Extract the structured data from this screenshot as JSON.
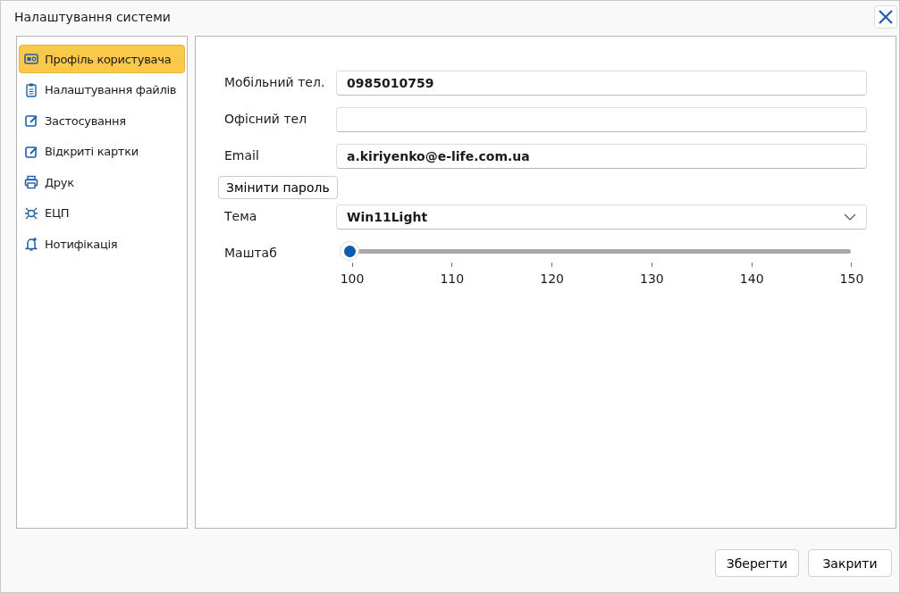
{
  "window": {
    "title": "Налаштування системи"
  },
  "sidebar": {
    "items": [
      {
        "label": "Профіль користувача",
        "selected": true
      },
      {
        "label": "Налаштування файлів",
        "selected": false
      },
      {
        "label": "Застосування",
        "selected": false
      },
      {
        "label": "Відкриті картки",
        "selected": false
      },
      {
        "label": "Друк",
        "selected": false
      },
      {
        "label": "ЕЦП",
        "selected": false
      },
      {
        "label": "Нотифікація",
        "selected": false
      }
    ]
  },
  "form": {
    "fields": [
      {
        "label": "Мобільний тел.",
        "value": "0985010759"
      },
      {
        "label": "Офісний тел"
      },
      {
        "label": "Email",
        "value": "a.kiriyenko@e-life.com.ua"
      }
    ],
    "change_password_button": "Змінити пароль",
    "theme": {
      "label": "Тема",
      "value": "Win11Light"
    },
    "scale": {
      "label": "Маштаб",
      "level": 0,
      "ticks": [
        "100",
        "110",
        "120",
        "130",
        "140",
        "150"
      ]
    }
  },
  "buttons": [
    "Зберегти",
    "Закрити"
  ]
}
